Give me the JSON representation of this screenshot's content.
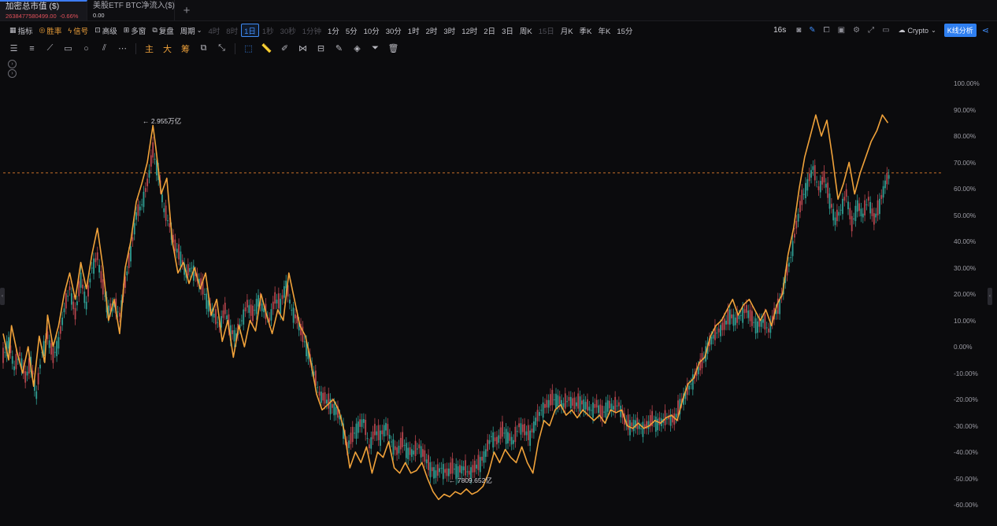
{
  "tabs": [
    {
      "title": "加密总市值 ($)",
      "value": "2638477580499.00",
      "change": "-0.66%",
      "active": true
    },
    {
      "title": "美股ETF BTC净流入($)",
      "value": "0.00",
      "active": false
    }
  ],
  "toolbar": {
    "indicators": "指标",
    "win_rate": "胜率",
    "signals": "信号",
    "advanced": "高级",
    "multi_window": "多窗",
    "review": "复盘",
    "period_label": "周期",
    "periods": [
      "4时",
      "8时",
      "1日",
      "1秒",
      "30秒",
      "1分钟",
      "1分",
      "5分",
      "10分",
      "30分",
      "1时",
      "2时",
      "3时",
      "12时",
      "2日",
      "3日",
      "周K",
      "15日",
      "月K",
      "季K",
      "年K",
      "15分"
    ],
    "active_period": "1日",
    "interval": "16s",
    "market": "Crypto",
    "kline_analysis": "K线分析"
  },
  "drawing_tools": [
    "主",
    "大",
    "筹"
  ],
  "chart_data": {
    "type": "line",
    "y_axis_ticks": [
      "100.00%",
      "90.00%",
      "80.00%",
      "70.00%",
      "60.00%",
      "50.00%",
      "40.00%",
      "30.00%",
      "20.00%",
      "10.00%",
      "0.00%",
      "-10.00%",
      "-20.00%",
      "-30.00%",
      "-40.00%",
      "-50.00%",
      "-60.00%"
    ],
    "ylim": [
      -63,
      103
    ],
    "reference_line": 66,
    "annotations": {
      "high": "2.955万亿",
      "low": "7809.652亿"
    },
    "series": [
      {
        "color": "#f0a23a",
        "kind": "line",
        "values": [
          [
            0,
            5
          ],
          [
            2,
            -5
          ],
          [
            3,
            8
          ],
          [
            5,
            -2
          ],
          [
            7,
            -10
          ],
          [
            9,
            0
          ],
          [
            11,
            -15
          ],
          [
            13,
            4
          ],
          [
            15,
            -6
          ],
          [
            16,
            12
          ],
          [
            18,
            0
          ],
          [
            20,
            8
          ],
          [
            22,
            20
          ],
          [
            24,
            28
          ],
          [
            26,
            18
          ],
          [
            28,
            32
          ],
          [
            30,
            22
          ],
          [
            32,
            35
          ],
          [
            34,
            45
          ],
          [
            36,
            30
          ],
          [
            38,
            10
          ],
          [
            40,
            18
          ],
          [
            42,
            5
          ],
          [
            44,
            30
          ],
          [
            46,
            40
          ],
          [
            48,
            55
          ],
          [
            50,
            62
          ],
          [
            52,
            70
          ],
          [
            54,
            84
          ],
          [
            55,
            76
          ],
          [
            57,
            58
          ],
          [
            59,
            64
          ],
          [
            61,
            40
          ],
          [
            63,
            28
          ],
          [
            65,
            32
          ],
          [
            67,
            24
          ],
          [
            69,
            30
          ],
          [
            71,
            22
          ],
          [
            73,
            28
          ],
          [
            75,
            12
          ],
          [
            77,
            18
          ],
          [
            79,
            2
          ],
          [
            81,
            10
          ],
          [
            83,
            -4
          ],
          [
            85,
            8
          ],
          [
            87,
            0
          ],
          [
            89,
            10
          ],
          [
            91,
            6
          ],
          [
            93,
            20
          ],
          [
            95,
            12
          ],
          [
            97,
            5
          ],
          [
            99,
            14
          ],
          [
            101,
            10
          ],
          [
            103,
            28
          ],
          [
            105,
            18
          ],
          [
            107,
            8
          ],
          [
            109,
            4
          ],
          [
            111,
            -6
          ],
          [
            113,
            -18
          ],
          [
            115,
            -24
          ],
          [
            117,
            -22
          ],
          [
            119,
            -20
          ],
          [
            121,
            -24
          ],
          [
            123,
            -32
          ],
          [
            125,
            -46
          ],
          [
            127,
            -40
          ],
          [
            129,
            -44
          ],
          [
            131,
            -38
          ],
          [
            133,
            -48
          ],
          [
            135,
            -40
          ],
          [
            137,
            -42
          ],
          [
            139,
            -36
          ],
          [
            141,
            -46
          ],
          [
            143,
            -48
          ],
          [
            145,
            -44
          ],
          [
            147,
            -48
          ],
          [
            149,
            -47
          ],
          [
            151,
            -44
          ],
          [
            153,
            -50
          ],
          [
            155,
            -55
          ],
          [
            157,
            -58
          ],
          [
            159,
            -56
          ],
          [
            161,
            -57
          ],
          [
            163,
            -55
          ],
          [
            165,
            -56
          ],
          [
            167,
            -54
          ],
          [
            169,
            -56
          ],
          [
            171,
            -55
          ],
          [
            173,
            -53
          ],
          [
            175,
            -48
          ],
          [
            177,
            -40
          ],
          [
            179,
            -44
          ],
          [
            181,
            -39
          ],
          [
            183,
            -42
          ],
          [
            185,
            -44
          ],
          [
            187,
            -38
          ],
          [
            189,
            -44
          ],
          [
            191,
            -48
          ],
          [
            193,
            -36
          ],
          [
            195,
            -28
          ],
          [
            197,
            -30
          ],
          [
            199,
            -24
          ],
          [
            201,
            -22
          ],
          [
            203,
            -26
          ],
          [
            205,
            -24
          ],
          [
            207,
            -27
          ],
          [
            209,
            -24
          ],
          [
            211,
            -26
          ],
          [
            213,
            -28
          ],
          [
            215,
            -26
          ],
          [
            217,
            -29
          ],
          [
            219,
            -24
          ],
          [
            221,
            -25
          ],
          [
            223,
            -24
          ],
          [
            225,
            -30
          ],
          [
            227,
            -31
          ],
          [
            229,
            -29
          ],
          [
            231,
            -31
          ],
          [
            233,
            -30
          ],
          [
            235,
            -28
          ],
          [
            237,
            -29
          ],
          [
            239,
            -27
          ],
          [
            241,
            -26
          ],
          [
            243,
            -28
          ],
          [
            245,
            -20
          ],
          [
            247,
            -14
          ],
          [
            249,
            -12
          ],
          [
            251,
            -6
          ],
          [
            253,
            -4
          ],
          [
            255,
            4
          ],
          [
            257,
            8
          ],
          [
            259,
            10
          ],
          [
            261,
            14
          ],
          [
            263,
            18
          ],
          [
            265,
            12
          ],
          [
            267,
            16
          ],
          [
            269,
            18
          ],
          [
            271,
            14
          ],
          [
            273,
            10
          ],
          [
            275,
            14
          ],
          [
            277,
            8
          ],
          [
            279,
            16
          ],
          [
            281,
            20
          ],
          [
            283,
            35
          ],
          [
            285,
            45
          ],
          [
            287,
            60
          ],
          [
            289,
            72
          ],
          [
            291,
            80
          ],
          [
            293,
            88
          ],
          [
            295,
            80
          ],
          [
            297,
            86
          ],
          [
            299,
            72
          ],
          [
            301,
            56
          ],
          [
            303,
            62
          ],
          [
            305,
            70
          ],
          [
            307,
            58
          ],
          [
            309,
            66
          ],
          [
            311,
            72
          ],
          [
            313,
            78
          ],
          [
            315,
            82
          ],
          [
            317,
            88
          ],
          [
            319,
            85
          ]
        ]
      },
      {
        "color": "#3aa59c",
        "kind": "candles",
        "values": [
          [
            0,
            -4
          ],
          [
            2,
            2
          ],
          [
            4,
            -8
          ],
          [
            6,
            -3
          ],
          [
            8,
            -12
          ],
          [
            10,
            -6
          ],
          [
            12,
            -18
          ],
          [
            14,
            -2
          ],
          [
            16,
            4
          ],
          [
            18,
            -4
          ],
          [
            20,
            2
          ],
          [
            22,
            14
          ],
          [
            24,
            22
          ],
          [
            26,
            12
          ],
          [
            28,
            26
          ],
          [
            30,
            16
          ],
          [
            32,
            30
          ],
          [
            34,
            34
          ],
          [
            36,
            22
          ],
          [
            38,
            14
          ],
          [
            40,
            16
          ],
          [
            42,
            12
          ],
          [
            44,
            24
          ],
          [
            46,
            36
          ],
          [
            48,
            50
          ],
          [
            50,
            54
          ],
          [
            52,
            62
          ],
          [
            54,
            74
          ],
          [
            56,
            66
          ],
          [
            58,
            52
          ],
          [
            60,
            46
          ],
          [
            62,
            38
          ],
          [
            64,
            34
          ],
          [
            66,
            28
          ],
          [
            68,
            30
          ],
          [
            70,
            26
          ],
          [
            72,
            22
          ],
          [
            74,
            16
          ],
          [
            76,
            12
          ],
          [
            78,
            8
          ],
          [
            80,
            14
          ],
          [
            82,
            6
          ],
          [
            84,
            4
          ],
          [
            86,
            10
          ],
          [
            88,
            16
          ],
          [
            90,
            12
          ],
          [
            92,
            18
          ],
          [
            94,
            14
          ],
          [
            96,
            10
          ],
          [
            98,
            18
          ],
          [
            100,
            16
          ],
          [
            102,
            24
          ],
          [
            104,
            14
          ],
          [
            106,
            10
          ],
          [
            108,
            4
          ],
          [
            110,
            -2
          ],
          [
            112,
            -10
          ],
          [
            114,
            -18
          ],
          [
            116,
            -20
          ],
          [
            118,
            -22
          ],
          [
            120,
            -24
          ],
          [
            122,
            -28
          ],
          [
            124,
            -38
          ],
          [
            126,
            -34
          ],
          [
            128,
            -30
          ],
          [
            130,
            -28
          ],
          [
            132,
            -38
          ],
          [
            134,
            -32
          ],
          [
            136,
            -34
          ],
          [
            138,
            -30
          ],
          [
            140,
            -36
          ],
          [
            142,
            -40
          ],
          [
            144,
            -36
          ],
          [
            146,
            -40
          ],
          [
            148,
            -40
          ],
          [
            150,
            -38
          ],
          [
            152,
            -42
          ],
          [
            154,
            -46
          ],
          [
            156,
            -48
          ],
          [
            158,
            -46
          ],
          [
            160,
            -48
          ],
          [
            162,
            -46
          ],
          [
            164,
            -47
          ],
          [
            166,
            -46
          ],
          [
            168,
            -48
          ],
          [
            170,
            -46
          ],
          [
            172,
            -44
          ],
          [
            174,
            -40
          ],
          [
            176,
            -34
          ],
          [
            178,
            -36
          ],
          [
            180,
            -32
          ],
          [
            182,
            -34
          ],
          [
            184,
            -36
          ],
          [
            186,
            -30
          ],
          [
            188,
            -32
          ],
          [
            190,
            -34
          ],
          [
            192,
            -28
          ],
          [
            194,
            -24
          ],
          [
            196,
            -22
          ],
          [
            198,
            -20
          ],
          [
            200,
            -20
          ],
          [
            202,
            -22
          ],
          [
            204,
            -20
          ],
          [
            206,
            -22
          ],
          [
            208,
            -21
          ],
          [
            210,
            -22
          ],
          [
            212,
            -24
          ],
          [
            214,
            -22
          ],
          [
            216,
            -26
          ],
          [
            218,
            -22
          ],
          [
            220,
            -23
          ],
          [
            222,
            -22
          ],
          [
            224,
            -28
          ],
          [
            226,
            -30
          ],
          [
            228,
            -29
          ],
          [
            230,
            -31
          ],
          [
            232,
            -30
          ],
          [
            234,
            -28
          ],
          [
            236,
            -29
          ],
          [
            238,
            -28
          ],
          [
            240,
            -27
          ],
          [
            242,
            -28
          ],
          [
            244,
            -22
          ],
          [
            246,
            -18
          ],
          [
            248,
            -14
          ],
          [
            250,
            -10
          ],
          [
            252,
            -6
          ],
          [
            254,
            0
          ],
          [
            256,
            4
          ],
          [
            258,
            6
          ],
          [
            260,
            8
          ],
          [
            262,
            12
          ],
          [
            264,
            10
          ],
          [
            266,
            12
          ],
          [
            268,
            14
          ],
          [
            270,
            10
          ],
          [
            272,
            8
          ],
          [
            274,
            10
          ],
          [
            276,
            6
          ],
          [
            278,
            12
          ],
          [
            280,
            16
          ],
          [
            282,
            26
          ],
          [
            284,
            34
          ],
          [
            286,
            46
          ],
          [
            288,
            56
          ],
          [
            290,
            62
          ],
          [
            292,
            68
          ],
          [
            294,
            60
          ],
          [
            296,
            64
          ],
          [
            298,
            56
          ],
          [
            300,
            48
          ],
          [
            302,
            52
          ],
          [
            304,
            58
          ],
          [
            306,
            46
          ],
          [
            308,
            54
          ],
          [
            310,
            50
          ],
          [
            312,
            56
          ],
          [
            314,
            48
          ],
          [
            316,
            54
          ],
          [
            318,
            62
          ],
          [
            320,
            66
          ]
        ]
      }
    ]
  }
}
